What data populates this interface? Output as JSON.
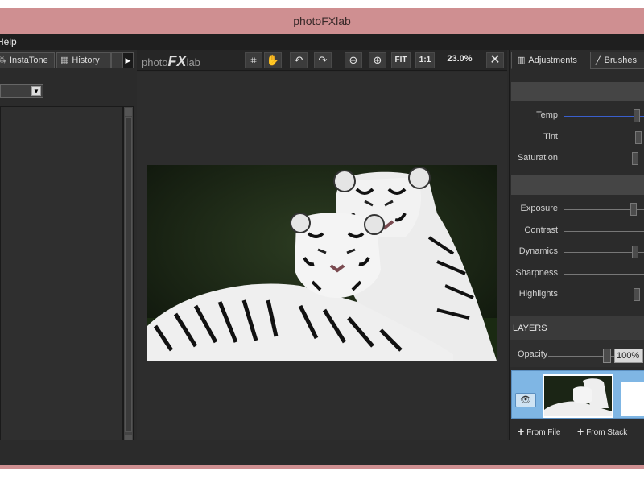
{
  "window": {
    "title": "photoFXlab"
  },
  "menubar": {
    "help_label": "Help"
  },
  "left_panel": {
    "tabs": [
      {
        "label": "InstaTone",
        "icon": "instatone-icon"
      },
      {
        "label": "History",
        "icon": "history-icon"
      }
    ],
    "tab_scroll_icon": "play-arrow-icon",
    "preset_select_value": ""
  },
  "toolbar": {
    "logo_prefix": "photo",
    "logo_fx": "FX",
    "logo_suffix": "lab",
    "crop_icon": "⌗",
    "hand_icon": "✋",
    "undo_icon": "↶",
    "redo_icon": "↷",
    "zoom_out_icon": "⊖",
    "zoom_in_icon": "⊕",
    "fit_label": "FIT",
    "one_to_one_label": "1:1",
    "zoom_level": "23.0%",
    "close_icon": "✕"
  },
  "right_panel": {
    "tabs": [
      {
        "label": "Adjustments",
        "icon": "adjustments-icon"
      },
      {
        "label": "Brushes",
        "icon": "brush-icon"
      }
    ],
    "color_sliders": [
      {
        "label": "Temp",
        "color": "#3a5fcd",
        "value": 0.9
      },
      {
        "label": "Tint",
        "color": "#3fa94a",
        "value": 0.92
      },
      {
        "label": "Saturation",
        "color": "#b04a4a",
        "value": 0.88
      }
    ],
    "tone_sliders": [
      {
        "label": "Exposure",
        "value": 0.86
      },
      {
        "label": "Contrast",
        "value": null
      },
      {
        "label": "Dynamics",
        "value": 0.88
      },
      {
        "label": "Sharpness",
        "value": null
      },
      {
        "label": "Highlights",
        "value": 0.9
      }
    ],
    "layers": {
      "header": "LAYERS",
      "opacity_label": "Opacity",
      "opacity_value": "100%",
      "opacity_fraction": 1.0,
      "eye_icon": "👁",
      "from_file_label": "From File",
      "from_stack_label": "From Stack"
    }
  },
  "colors": {
    "title_bar": "#cf8f91",
    "panel_bg": "#2b2b2b",
    "layer_selected": "#7fb6e4"
  }
}
